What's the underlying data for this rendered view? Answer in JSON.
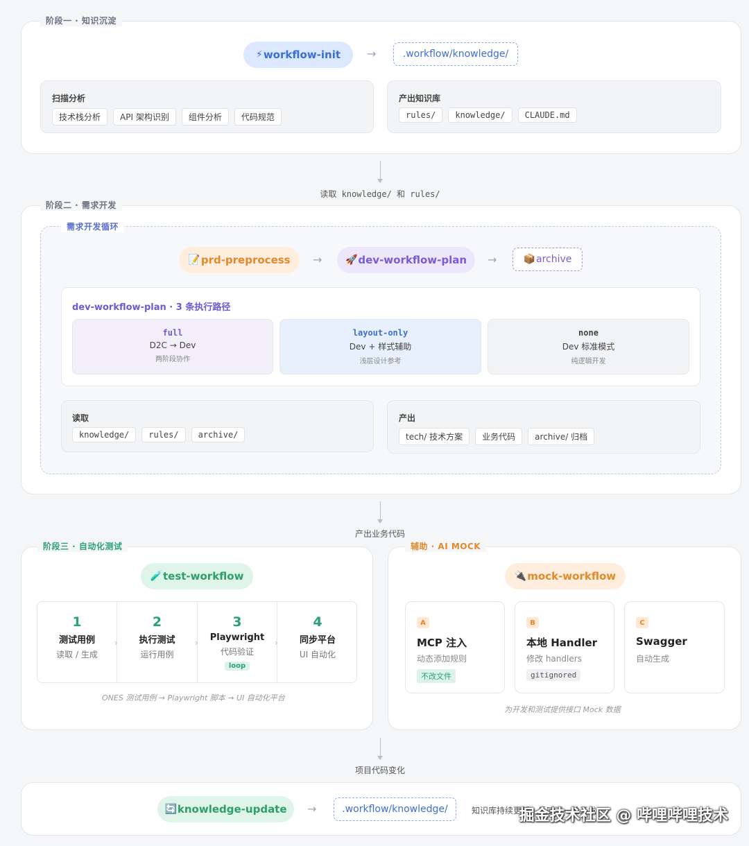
{
  "stage1": {
    "label": "阶段一 · 知识沉淀",
    "init_pill": "workflow-init",
    "init_icon": "⚡",
    "target": ".workflow/knowledge/",
    "scan": {
      "title": "扫描分析",
      "chips": [
        "技术栈分析",
        "API 架构识别",
        "组件分析",
        "代码规范"
      ]
    },
    "output": {
      "title": "产出知识库",
      "chips": [
        "rules/",
        "knowledge/",
        "CLAUDE.md"
      ]
    }
  },
  "connector1": "读取 knowledge/ 和 rules/",
  "stage2": {
    "label": "阶段二 · 需求开发",
    "loop_label": "需求开发循环",
    "pills": {
      "prd": "prd-preprocess",
      "prd_icon": "📝",
      "plan": "dev-workflow-plan",
      "plan_icon": "🚀",
      "archive": "archive",
      "archive_icon": "📦"
    },
    "paths_title": "dev-workflow-plan · 3 条执行路径",
    "paths": [
      {
        "name": "full",
        "main": "D2C → Dev",
        "sub": "两阶段协作"
      },
      {
        "name": "layout-only",
        "main": "Dev + 样式辅助",
        "sub": "浅层设计参考"
      },
      {
        "name": "none",
        "main": "Dev 标准模式",
        "sub": "纯逻辑开发"
      }
    ],
    "read": {
      "title": "读取",
      "chips": [
        "knowledge/",
        "rules/",
        "archive/"
      ]
    },
    "produce": {
      "title": "产出",
      "chips": [
        "tech/ 技术方案",
        "业务代码",
        "archive/ 归档"
      ]
    }
  },
  "connector2": "产出业务代码",
  "stage3": {
    "label": "阶段三 · 自动化测试",
    "pill": "test-workflow",
    "pill_icon": "🧪",
    "steps": [
      {
        "num": "1",
        "title": "测试用例",
        "sub": "读取 / 生成"
      },
      {
        "num": "2",
        "title": "执行测试",
        "sub": "运行用例"
      },
      {
        "num": "3",
        "title": "Playwright",
        "sub": "代码验证",
        "badge": "loop"
      },
      {
        "num": "4",
        "title": "同步平台",
        "sub": "UI 自动化"
      }
    ],
    "note": "ONES 测试用例 → Playwright 脚本 → UI 自动化平台"
  },
  "aux": {
    "label": "辅助 · AI MOCK",
    "pill": "mock-workflow",
    "pill_icon": "🔌",
    "cards": [
      {
        "badge": "A",
        "title": "MCP 注入",
        "sub": "动态添加规则",
        "tag": "不改文件"
      },
      {
        "badge": "B",
        "title": "本地 Handler",
        "sub": "修改 handlers",
        "tag": "gitignored"
      },
      {
        "badge": "C",
        "title": "Swagger",
        "sub": "自动生成"
      }
    ],
    "note": "为开发和测试提供接口 Mock 数据"
  },
  "connector3": "项目代码变化",
  "stage4": {
    "pill": "knowledge-update",
    "pill_icon": "🔄",
    "target": ".workflow/knowledge/",
    "trailing": "知识库持续更新，反哺下一轮开发"
  },
  "watermark": "掘金技术社区 @ 哔哩哔哩技术",
  "colors": {
    "blue": "#3b6fd8",
    "orange": "#e28a2b",
    "purple": "#7b5bd6",
    "green": "#2aa07a"
  }
}
